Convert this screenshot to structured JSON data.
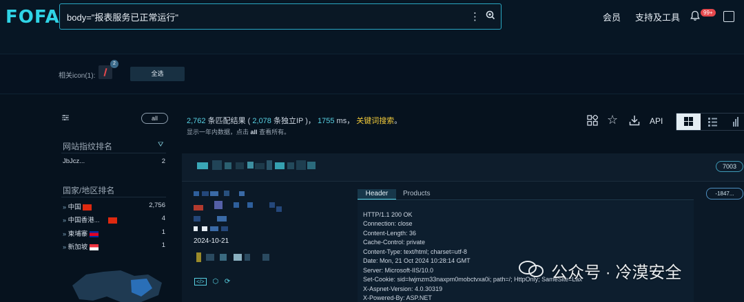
{
  "header": {
    "logo": "FOFA",
    "search_value": "body=\"报表服务已正常运行\"",
    "nav_member": "会员",
    "nav_tools": "支持及工具",
    "notif_badge": "99+"
  },
  "icon_filter": {
    "label": "相关icon(1):",
    "icon_count": "2",
    "select_all": "全选"
  },
  "sidebar": {
    "all_label": "all",
    "fingerprint_title": "网站指纹排名",
    "fingerprints": [
      {
        "name": "JbJcz...",
        "count": "2"
      }
    ],
    "region_title": "国家/地区排名",
    "regions": [
      {
        "name": "中国",
        "count": "2,756"
      },
      {
        "name": "中国香港...",
        "count": "4"
      },
      {
        "name": "柬埔寨",
        "count": "1"
      },
      {
        "name": "新加坡",
        "count": "1"
      }
    ]
  },
  "results": {
    "total": "2,762",
    "total_suffix": "条匹配结果",
    "ip_open": "(",
    "unique_ip": "2,078",
    "ip_suffix": "条独立IP",
    "ip_close": ")，",
    "time": "1755",
    "time_suffix": "ms，",
    "keyword_search": "关键词搜索",
    "period_end": "。",
    "sub_prefix": "显示一年内数据，点击",
    "sub_all": "all",
    "sub_suffix": "查看所有。",
    "api_label": "API"
  },
  "card": {
    "port_tag": "7003",
    "date": "2024-10-21",
    "tab_header": "Header",
    "tab_products": "Products",
    "id_tag": "-1847...",
    "header_lines": [
      "HTTP/1.1 200 OK",
      "Connection: close",
      "Content-Length: 36",
      "Cache-Control: private",
      "Content-Type: text/html; charset=utf-8",
      "Date: Mon, 21 Oct 2024 10:28:14 GMT",
      "Server: Microsoft-IIS/10.0",
      "Set-Cookie: sid=lwjmzm33naxpm0mobctvxa0i; path=/; HttpOnly; SameSite=Lax",
      "X-Aspnet-Version: 4.0.30319",
      "X-Powered-By: ASP.NET"
    ]
  },
  "watermark": {
    "text": "公众号 · 冷漠安全"
  },
  "colors": {
    "accent": "#58d2e4",
    "keyword": "#f0c93a",
    "badge": "#e5484d",
    "bg": "#06121e"
  }
}
